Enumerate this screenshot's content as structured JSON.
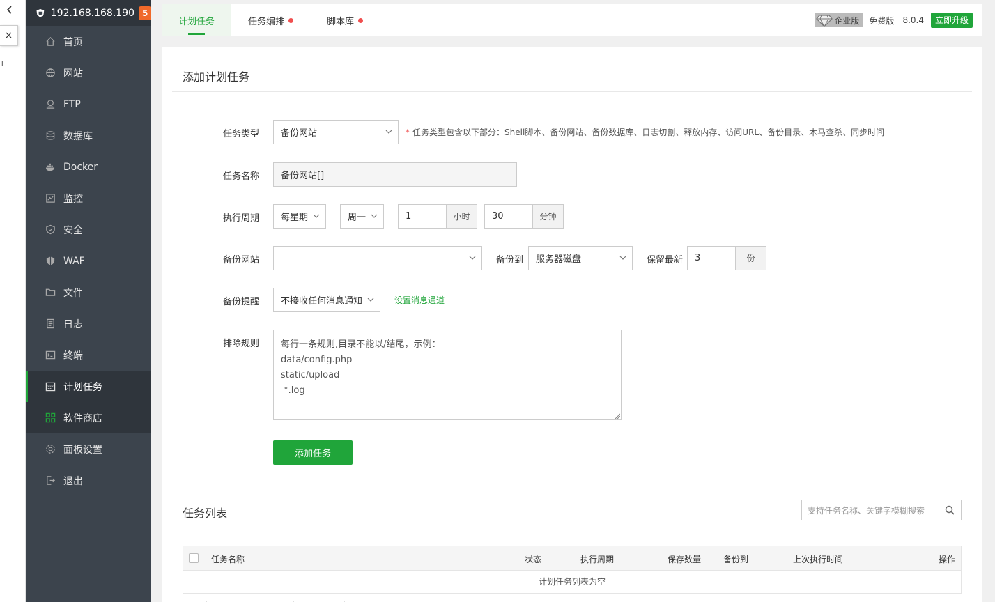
{
  "browser": {
    "close_label": "×",
    "side_fragment": "T"
  },
  "sidebar": {
    "ip": "192.168.168.190",
    "badge": "5",
    "items": [
      {
        "label": "首页",
        "icon": "home-icon"
      },
      {
        "label": "网站",
        "icon": "globe-icon"
      },
      {
        "label": "FTP",
        "icon": "ftp-icon"
      },
      {
        "label": "数据库",
        "icon": "database-icon"
      },
      {
        "label": "Docker",
        "icon": "docker-icon"
      },
      {
        "label": "监控",
        "icon": "monitor-icon"
      },
      {
        "label": "安全",
        "icon": "shield-icon"
      },
      {
        "label": "WAF",
        "icon": "waf-icon"
      },
      {
        "label": "文件",
        "icon": "folder-icon"
      },
      {
        "label": "日志",
        "icon": "log-icon"
      },
      {
        "label": "终端",
        "icon": "terminal-icon"
      },
      {
        "label": "计划任务",
        "icon": "calendar-icon"
      },
      {
        "label": "软件商店",
        "icon": "apps-icon"
      },
      {
        "label": "面板设置",
        "icon": "gear-icon"
      },
      {
        "label": "退出",
        "icon": "logout-icon"
      }
    ]
  },
  "tabs": [
    {
      "label": "计划任务"
    },
    {
      "label": "任务编排"
    },
    {
      "label": "脚本库"
    }
  ],
  "topright": {
    "enterprise": "企业版",
    "free": "免费版",
    "version": "8.0.4",
    "upgrade": "立即升级"
  },
  "form": {
    "title": "添加计划任务",
    "type_label": "任务类型",
    "type_value": "备份网站",
    "type_hint": "任务类型包含以下部分：Shell脚本、备份网站、备份数据库、日志切割、释放内存、访问URL、备份目录、木马查杀、同步时间",
    "name_label": "任务名称",
    "name_value": "备份网站[]",
    "cycle_label": "执行周期",
    "cycle_value": "每星期",
    "weekday_value": "周一",
    "hour_value": "1",
    "hour_unit": "小时",
    "minute_value": "30",
    "minute_unit": "分钟",
    "site_label": "备份网站",
    "site_value": "",
    "backup_to_label": "备份到",
    "backup_to_value": "服务器磁盘",
    "keep_label": "保留最新",
    "keep_value": "3",
    "keep_unit": "份",
    "notify_label": "备份提醒",
    "notify_value": "不接收任何消息通知",
    "notify_link": "设置消息通道",
    "exclude_label": "排除规则",
    "exclude_lines": [
      "每行一条规则,目录不能以/结尾，示例：",
      "data/config.php",
      "static/upload",
      " *.log"
    ],
    "submit": "添加任务"
  },
  "list": {
    "title": "任务列表",
    "search_placeholder": "支持任务名称、关键字模糊搜索",
    "columns": [
      "任务名称",
      "状态",
      "执行周期",
      "保存数量",
      "备份到",
      "上次执行时间",
      "操作"
    ],
    "empty": "计划任务列表为空"
  },
  "colors": {
    "accent": "#20a53a",
    "sidebar_bg": "#3c444d",
    "badge": "#f0692a",
    "dot": "#f04e4e"
  }
}
